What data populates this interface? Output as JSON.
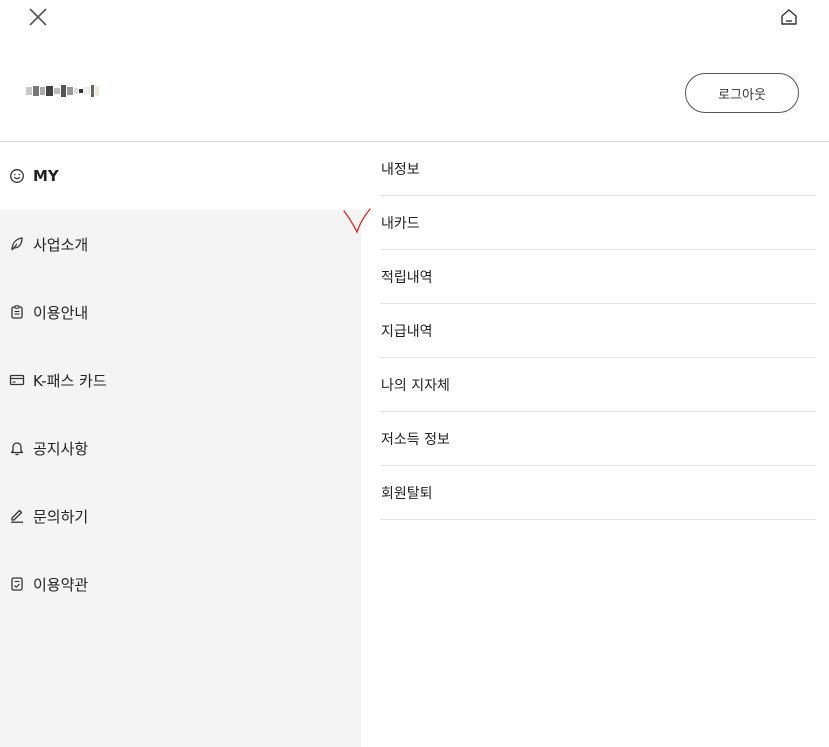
{
  "header": {
    "close_icon": "close-icon",
    "home_icon": "home-icon",
    "logout_label": "로그아웃"
  },
  "sidebar": {
    "items": [
      {
        "label": "MY",
        "icon": "smile-icon",
        "active": true
      },
      {
        "label": "사업소개",
        "icon": "leaf-icon",
        "active": false
      },
      {
        "label": "이용안내",
        "icon": "clipboard-icon",
        "active": false
      },
      {
        "label": "K-패스 카드",
        "icon": "card-icon",
        "active": false
      },
      {
        "label": "공지사항",
        "icon": "bell-icon",
        "active": false
      },
      {
        "label": "문의하기",
        "icon": "pencil-icon",
        "active": false
      },
      {
        "label": "이용약관",
        "icon": "document-check-icon",
        "active": false
      }
    ]
  },
  "submenu": {
    "items": [
      {
        "label": "내정보"
      },
      {
        "label": "내카드"
      },
      {
        "label": "적립내역"
      },
      {
        "label": "지급내역"
      },
      {
        "label": "나의 지자체"
      },
      {
        "label": "저소득 정보"
      },
      {
        "label": "회원탈퇴"
      }
    ]
  },
  "colors": {
    "sidebar_bg": "#f4f4f4",
    "active_bg": "#ffffff",
    "annotation_red": "#e02020"
  }
}
